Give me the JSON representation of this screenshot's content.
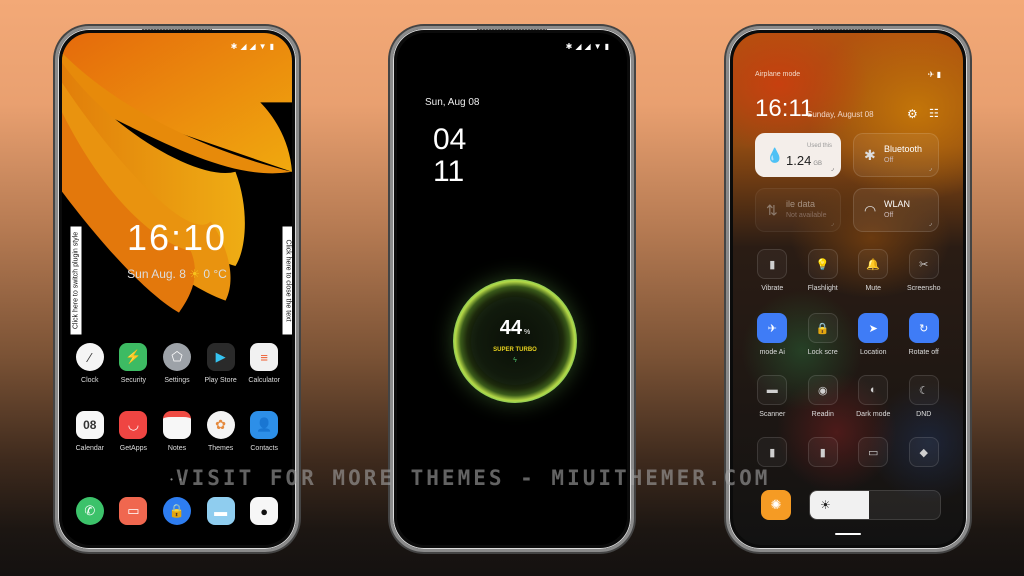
{
  "status_icons": [
    "bluetooth-icon",
    "signal-icon",
    "signal-icon",
    "wifi-icon",
    "battery-icon"
  ],
  "phone1": {
    "lock_time": "16:10",
    "lock_date": "Sun Aug. 8",
    "weather_icon": "☀",
    "temperature": "0 °C",
    "side_text_left": "Click here to switch plugin style",
    "side_text_right": "Click here to close the text",
    "apps_row1": [
      {
        "label": "Clock",
        "icon": "clock-icon",
        "glyph": "⁄",
        "bg": "#f5f5f5",
        "fg": "#333"
      },
      {
        "label": "Security",
        "icon": "shield-icon",
        "glyph": "⚡",
        "bg": "#3dbb63",
        "fg": "#fff"
      },
      {
        "label": "Settings",
        "icon": "gear-icon",
        "glyph": "⬠",
        "bg": "#9da2a8",
        "fg": "#fff"
      },
      {
        "label": "Play Store",
        "icon": "play-store-icon",
        "glyph": "▶",
        "bg": "#2a2a2a",
        "fg": "#35c3f0"
      },
      {
        "label": "Calculator",
        "icon": "calculator-icon",
        "glyph": "≡",
        "bg": "#f1f1f1",
        "fg": "#ef5a2d"
      }
    ],
    "apps_row2": [
      {
        "label": "Calendar",
        "icon": "calendar-icon",
        "glyph": "08",
        "bg": "#f7f7f7",
        "fg": "#333"
      },
      {
        "label": "GetApps",
        "icon": "shopping-bag-icon",
        "glyph": "◡",
        "bg": "#ef4542",
        "fg": "#fff"
      },
      {
        "label": "Notes",
        "icon": "notes-icon",
        "glyph": "",
        "bg": "#f7f7f7",
        "fg": "#e44"
      },
      {
        "label": "Themes",
        "icon": "themes-icon",
        "glyph": "✿",
        "bg": "#f4f4f4",
        "fg": "#e58a3f"
      },
      {
        "label": "Contacts",
        "icon": "contacts-icon",
        "glyph": "👤",
        "bg": "#2d8fe8",
        "fg": "#fff"
      }
    ],
    "page_dots": "• •",
    "dock": [
      {
        "icon": "phone-icon",
        "glyph": "✆",
        "bg": "#3cc26a",
        "fg": "#fff"
      },
      {
        "icon": "messages-icon",
        "glyph": "▭",
        "bg": "#f0674f",
        "fg": "#fff"
      },
      {
        "icon": "lock-icon",
        "glyph": "🔒",
        "bg": "#2e7df0",
        "fg": "#fff"
      },
      {
        "icon": "gallery-icon",
        "glyph": "▬",
        "bg": "#8fcdef",
        "fg": "#fff"
      },
      {
        "icon": "camera-icon",
        "glyph": "●",
        "bg": "#f7f7f7",
        "fg": "#111"
      }
    ]
  },
  "phone2": {
    "date": "Sun, Aug 08",
    "hour": "04",
    "minute": "11",
    "battery_percent": "44",
    "percent_sign": "%",
    "battery_mode": "SUPER TURBO",
    "charging_icon": "ϟ"
  },
  "phone3": {
    "airplane_label": "Airplane mode",
    "status_text": "✈ ▮",
    "time": "16:11",
    "date": "Sunday, August 08",
    "gear_icon": "⚙",
    "edit_icon": "☷",
    "data_tile": {
      "used_label": "Used this",
      "value": "1.24",
      "unit": "GB",
      "icon": "💧"
    },
    "bluetooth_tile": {
      "title": "Bluetooth",
      "sub": "Off",
      "icon": "✱"
    },
    "mobile_tile": {
      "title": "ile data",
      "sub": "Not available",
      "icon": "⇅"
    },
    "wlan_tile": {
      "title": "WLAN",
      "sub": "Off",
      "icon": "◠"
    },
    "toggles_row1": [
      {
        "label": "Vibrate",
        "icon": "vibrate-icon",
        "glyph": "▮",
        "on": false
      },
      {
        "label": "Flashlight",
        "icon": "flashlight-icon",
        "glyph": "💡",
        "on": false
      },
      {
        "label": "Mute",
        "icon": "bell-icon",
        "glyph": "🔔",
        "on": false
      },
      {
        "label": "Screensho",
        "icon": "scissors-icon",
        "glyph": "✂",
        "on": false
      }
    ],
    "toggles_row2": [
      {
        "label": "mode     Ai",
        "icon": "airplane-icon",
        "glyph": "✈",
        "on": true
      },
      {
        "label": "Lock scre",
        "icon": "lock-icon",
        "glyph": "🔒",
        "on": false
      },
      {
        "label": "Location",
        "icon": "location-icon",
        "glyph": "➤",
        "on": true
      },
      {
        "label": "Rotate off",
        "icon": "rotate-icon",
        "glyph": "↻",
        "on": true
      }
    ],
    "toggles_row3": [
      {
        "label": "Scanner",
        "icon": "scanner-icon",
        "glyph": "▬",
        "on": false
      },
      {
        "label": "Readin",
        "icon": "eye-icon",
        "glyph": "◉",
        "on": false
      },
      {
        "label": "Dark mode",
        "icon": "dark-mode-icon",
        "glyph": "◐",
        "on": false
      },
      {
        "label": "DND",
        "icon": "moon-icon",
        "glyph": "☾",
        "on": false
      }
    ],
    "toggles_row4": [
      {
        "label": "",
        "icon": "battery-saver-icon",
        "glyph": "▮",
        "on": false
      },
      {
        "label": "",
        "icon": "ultra-battery-icon",
        "glyph": "▮",
        "on": false
      },
      {
        "label": "",
        "icon": "cast-icon",
        "glyph": "▭",
        "on": false
      },
      {
        "label": "",
        "icon": "nearby-share-icon",
        "glyph": "◆",
        "on": false
      }
    ],
    "auto_brightness_icon": "✺",
    "brightness_icon": "☀",
    "brightness_level": 0.45
  },
  "watermark": "VISIT FOR MORE THEMES - MIUITHEMER.COM"
}
